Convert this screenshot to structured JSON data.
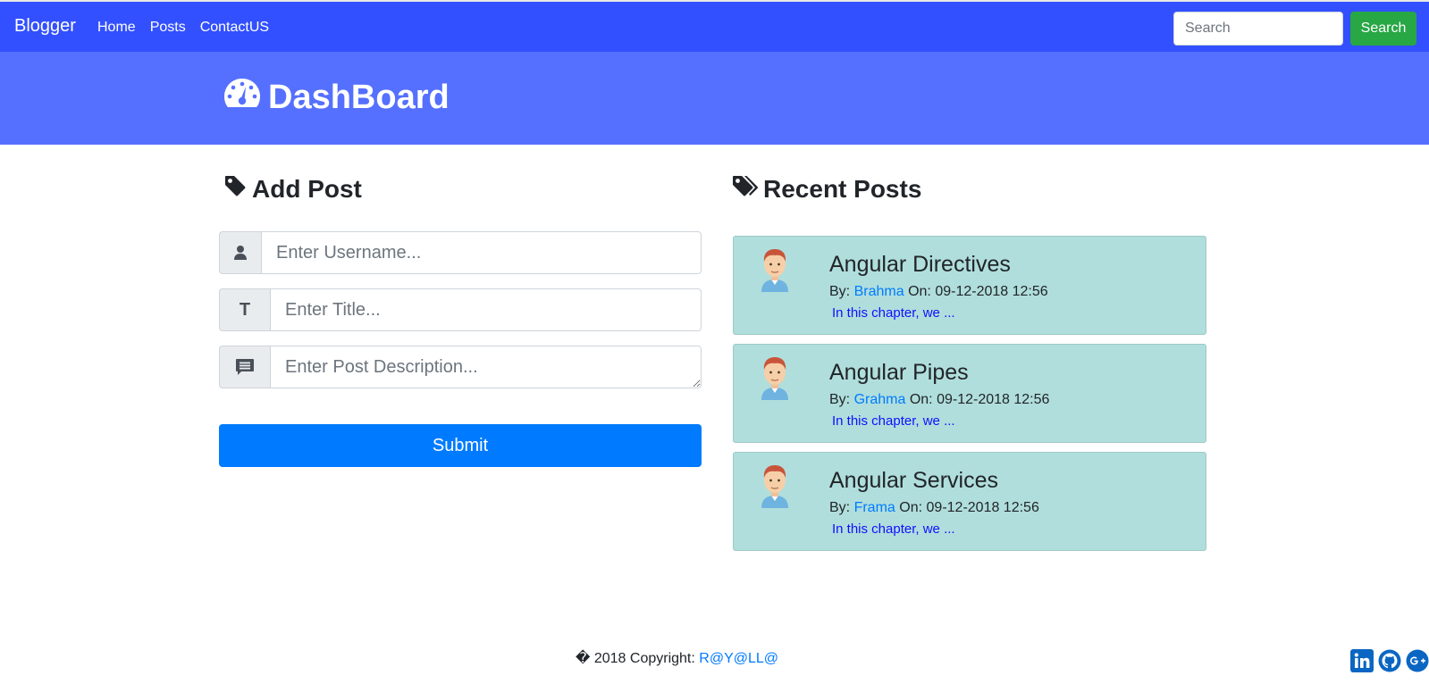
{
  "navbar": {
    "brand": "Blogger",
    "links": [
      "Home",
      "Posts",
      "ContactUS"
    ],
    "search_placeholder": "Search",
    "search_button": "Search"
  },
  "header": {
    "title": "DashBoard",
    "icon": "tachometer-icon"
  },
  "add_post": {
    "heading": "Add Post",
    "heading_icon": "tag-icon",
    "username_placeholder": "Enter Username...",
    "username_icon": "user-icon",
    "title_placeholder": "Enter Title...",
    "title_icon": "T",
    "description_placeholder": "Enter Post Description...",
    "description_icon": "comment-icon",
    "submit_label": "Submit"
  },
  "recent_posts": {
    "heading": "Recent Posts",
    "heading_icon": "tags-icon",
    "posts": [
      {
        "title": "Angular Directives",
        "by_label": "By:",
        "author": "Brahma",
        "on_label": "On:",
        "date": "09-12-2018 12:56",
        "excerpt": "In this chapter, we ..."
      },
      {
        "title": "Angular Pipes",
        "by_label": "By:",
        "author": "Grahma",
        "on_label": "On:",
        "date": "09-12-2018 12:56",
        "excerpt": "In this chapter, we ..."
      },
      {
        "title": "Angular Services",
        "by_label": "By:",
        "author": "Frama",
        "on_label": "On:",
        "date": "09-12-2018 12:56",
        "excerpt": "In this chapter, we ..."
      }
    ]
  },
  "footer": {
    "copyright_symbol": "�",
    "copyright_text": "2018 Copyright:",
    "copyright_link": "R@Y@LL@",
    "social_icons": [
      "linkedin-icon",
      "github-icon",
      "google-plus-icon"
    ]
  },
  "colors": {
    "navbar": "#3250ff",
    "header": "#5570ff",
    "search_button": "#28a745",
    "submit_button": "#007bff",
    "post_card": "#b0dedc",
    "link": "#007bff",
    "excerpt": "#1010ff"
  }
}
